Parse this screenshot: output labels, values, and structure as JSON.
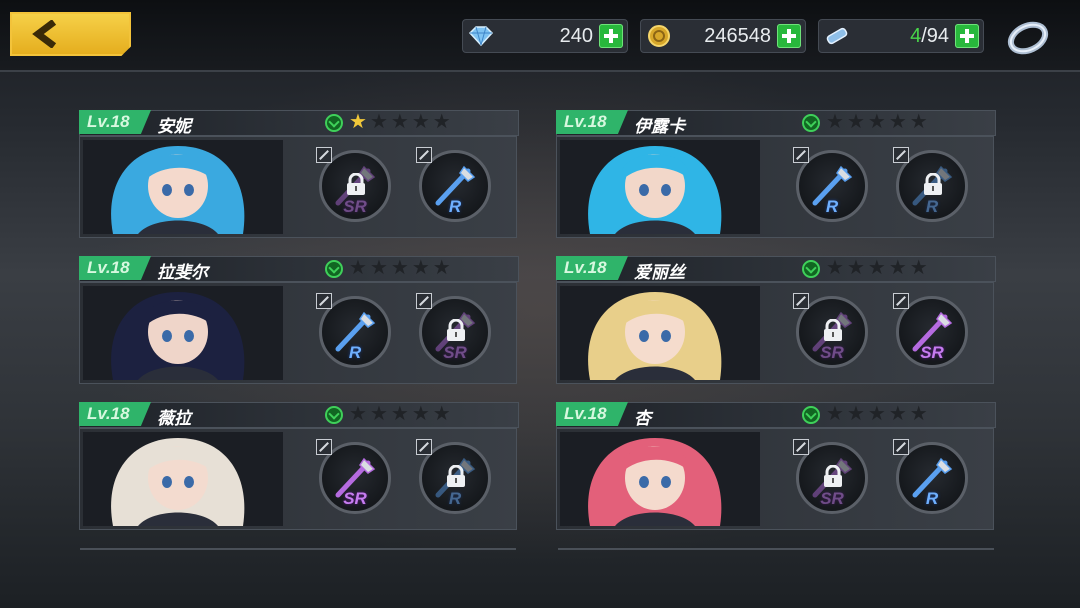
{
  "resources": {
    "diamonds": "240",
    "gold": "246548",
    "stamina_current": "4",
    "stamina_max": "/94"
  },
  "characters": [
    {
      "level": "Lv.18",
      "name": "安妮",
      "stars": 1,
      "hair": "#3aa9e0",
      "skin": "#f4d9cc",
      "slots": [
        {
          "rarity": "SR",
          "locked": true
        },
        {
          "rarity": "R",
          "locked": false
        }
      ]
    },
    {
      "level": "Lv.18",
      "name": "伊露卡",
      "stars": 0,
      "hair": "#2fb5e6",
      "skin": "#f2d7c9",
      "slots": [
        {
          "rarity": "R",
          "locked": false
        },
        {
          "rarity": "R",
          "locked": true
        }
      ]
    },
    {
      "level": "Lv.18",
      "name": "拉斐尔",
      "stars": 0,
      "hair": "#1c2140",
      "skin": "#efd5c9",
      "slots": [
        {
          "rarity": "R",
          "locked": false
        },
        {
          "rarity": "SR",
          "locked": true
        }
      ]
    },
    {
      "level": "Lv.18",
      "name": "爱丽丝",
      "stars": 0,
      "hair": "#e8cf8a",
      "skin": "#f5dccd",
      "slots": [
        {
          "rarity": "SR",
          "locked": true
        },
        {
          "rarity": "SR",
          "locked": false
        }
      ]
    },
    {
      "level": "Lv.18",
      "name": "薇拉",
      "stars": 0,
      "hair": "#e7e0d6",
      "skin": "#f3dbcf",
      "slots": [
        {
          "rarity": "SR",
          "locked": false
        },
        {
          "rarity": "R",
          "locked": true
        }
      ]
    },
    {
      "level": "Lv.18",
      "name": "杏",
      "stars": 0,
      "hair": "#e3607a",
      "skin": "#f4dacd",
      "slots": [
        {
          "rarity": "SR",
          "locked": true
        },
        {
          "rarity": "R",
          "locked": false
        }
      ]
    }
  ]
}
